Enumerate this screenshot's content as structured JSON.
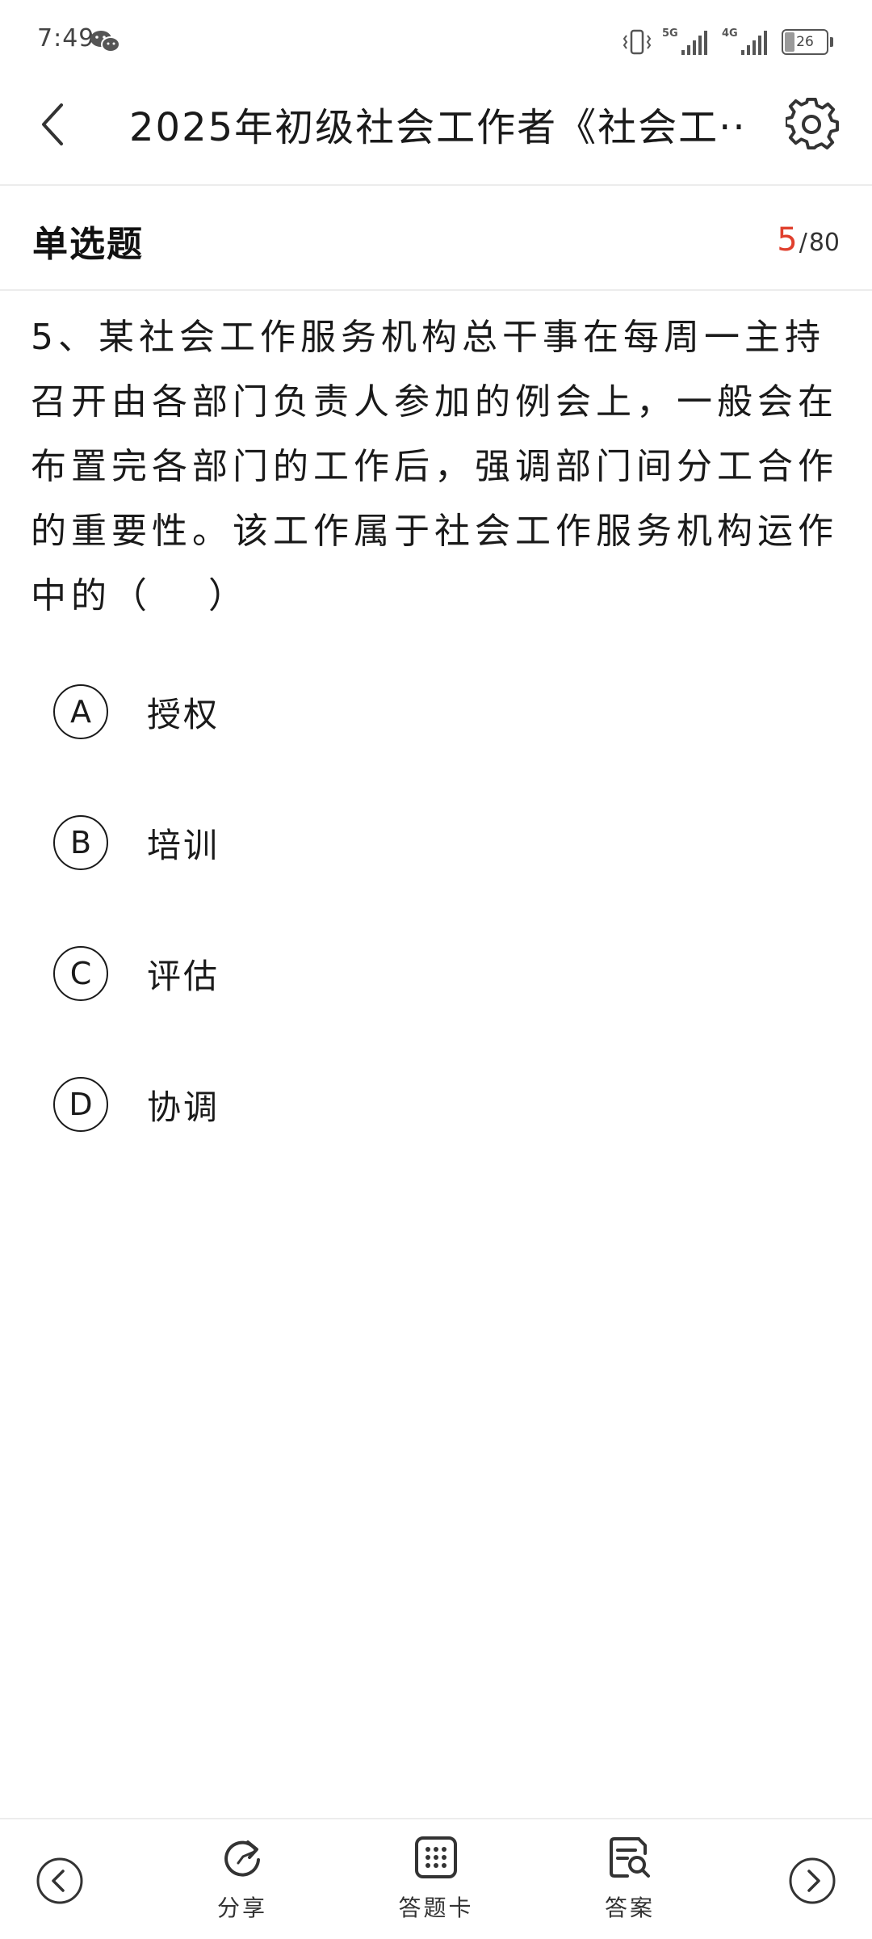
{
  "status_bar": {
    "time": "7:49",
    "network_1": "5G",
    "network_2": "4G",
    "battery": "26"
  },
  "header": {
    "title": "2025年初级社会工作者《社会工··"
  },
  "question_header": {
    "type_label": "单选题",
    "current": "5",
    "separator": "/",
    "total": "80"
  },
  "question": {
    "text": "5、某社会工作服务机构总干事在每周一主持召开由各部门负责人参加的例会上，一般会在布置完各部门的工作后，强调部门间分工合作的重要性。该工作属于社会工作服务机构运作中的（　 ）"
  },
  "options": [
    {
      "letter": "A",
      "text": "授权"
    },
    {
      "letter": "B",
      "text": "培训"
    },
    {
      "letter": "C",
      "text": "评估"
    },
    {
      "letter": "D",
      "text": "协调"
    }
  ],
  "bottom_nav": {
    "share_label": "分享",
    "answer_card_label": "答题卡",
    "answer_label": "答案"
  },
  "colors": {
    "accent": "#e0402e",
    "text": "#1a1a1a",
    "divider": "#ececec"
  },
  "icons": {
    "back": "chevron-left-icon",
    "settings": "gear-icon",
    "prev": "circle-chevron-left-icon",
    "next": "circle-chevron-right-icon",
    "share": "refresh-share-icon",
    "answer_card": "grid-icon",
    "answer": "document-search-icon"
  }
}
